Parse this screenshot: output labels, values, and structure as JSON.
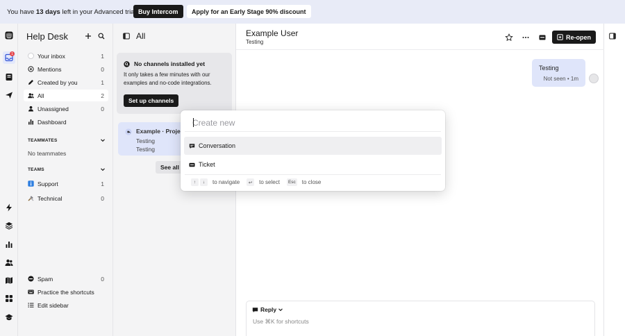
{
  "banner": {
    "prefix": "You have ",
    "days": "13 days",
    "suffix": " left in your Advanced trial",
    "buy_label": "Buy Intercom",
    "discount_label": "Apply for an Early Stage 90% discount"
  },
  "rail": {
    "inbox_badge": "1",
    "icons": [
      "logo-icon",
      "inbox-icon",
      "book-icon",
      "send-icon",
      "bolt-icon",
      "layers-icon",
      "chart-icon",
      "users-icon",
      "map-icon",
      "apps-icon",
      "learn-icon"
    ]
  },
  "sidebar": {
    "title": "Help Desk",
    "items": [
      {
        "label": "Your inbox",
        "count": "1"
      },
      {
        "label": "Mentions",
        "count": "0"
      },
      {
        "label": "Created by you",
        "count": "1"
      },
      {
        "label": "All",
        "count": "2"
      },
      {
        "label": "Unassigned",
        "count": "0"
      },
      {
        "label": "Dashboard",
        "count": ""
      }
    ],
    "teammates_heading": "TEAMMATES",
    "no_teammates": "No teammates",
    "teams_heading": "TEAMS",
    "teams": [
      {
        "label": "Support",
        "count": "1"
      },
      {
        "label": "Technical",
        "count": "0"
      }
    ],
    "spam": {
      "label": "Spam",
      "count": "0"
    },
    "shortcuts_label": "Practice the shortcuts",
    "edit_label": "Edit sidebar"
  },
  "list": {
    "title": "All",
    "card": {
      "title": "No channels installed yet",
      "body": "It only takes a few minutes with our examples and no-code integrations.",
      "button": "Set up channels"
    },
    "conversation": {
      "title": "Example · Project",
      "line1": "Testing",
      "line2": "Testing"
    },
    "see_all": "See all"
  },
  "main": {
    "name": "Example User",
    "subtitle": "Testing",
    "reopen_label": "Re-open",
    "message": {
      "text": "Testing",
      "meta": "Not seen • 1m"
    },
    "composer": {
      "reply_label": "Reply",
      "placeholder": "Use ⌘K for shortcuts"
    }
  },
  "palette": {
    "placeholder": "Create new",
    "options": [
      "Conversation",
      "Ticket"
    ],
    "footer": {
      "navigate": "to navigate",
      "select": "to select",
      "close": "to close",
      "up_key": "↑",
      "down_key": "↓",
      "enter_key": "↩",
      "esc_key": "Esc"
    }
  },
  "colors": {
    "accent": "#dfe5fa",
    "dark": "#1a1a1a",
    "badge": "#e5484d"
  }
}
